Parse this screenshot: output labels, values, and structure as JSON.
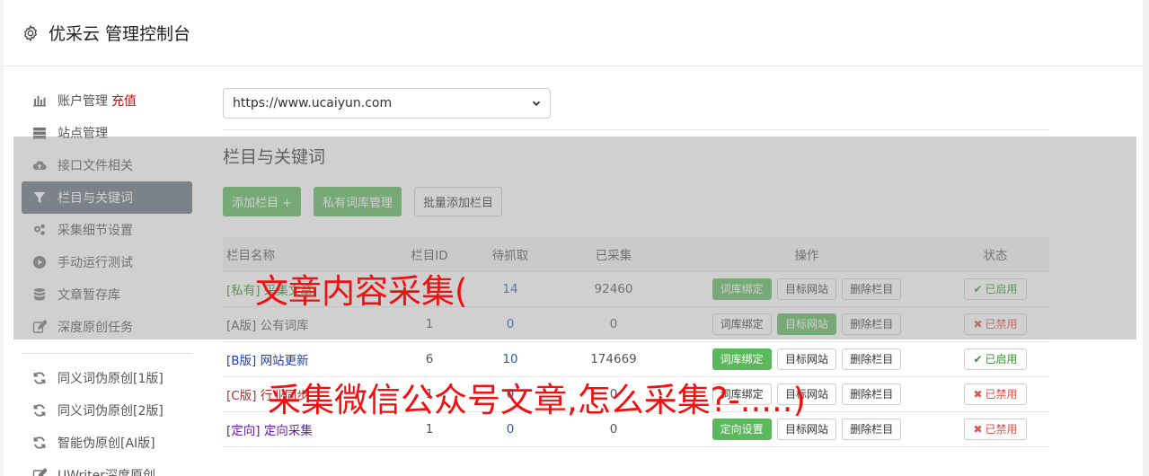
{
  "header": {
    "title": "优采云 管理控制台"
  },
  "sidebar": {
    "items": [
      {
        "label": "账户管理",
        "extra": "充值",
        "icon": "bar-chart-icon"
      },
      {
        "label": "站点管理",
        "icon": "server-icon"
      },
      {
        "label": "接口文件相关",
        "icon": "cloud-upload-icon"
      },
      {
        "label": "栏目与关键词",
        "icon": "filter-icon",
        "active": true
      },
      {
        "label": "采集细节设置",
        "icon": "cogs-icon"
      },
      {
        "label": "手动运行测试",
        "icon": "play-circle-icon"
      },
      {
        "label": "文章暂存库",
        "icon": "database-icon"
      },
      {
        "label": "深度原创任务",
        "icon": "edit-icon"
      }
    ],
    "items2": [
      {
        "label": "同义词伪原创[1版]",
        "icon": "refresh-icon"
      },
      {
        "label": "同义词伪原创[2版]",
        "icon": "refresh-icon"
      },
      {
        "label": "智能伪原创[AI版]",
        "icon": "refresh-icon"
      },
      {
        "label": "UWriter深度原创",
        "icon": "edit-icon"
      }
    ]
  },
  "main": {
    "site_select": "https://www.ucaiyun.com",
    "section_title": "栏目与关键词",
    "toolbar": {
      "add": "添加栏目 +",
      "private": "私有词库管理",
      "batch": "批量添加栏目"
    },
    "table": {
      "headers": [
        "栏目名称",
        "栏目ID",
        "待抓取",
        "已采集",
        "操作",
        "状态"
      ],
      "rows": [
        {
          "tag": "[私有]",
          "name": "采集文章",
          "id": "1",
          "pending": "14",
          "collected": "92460",
          "b1": "词库绑定",
          "b2": "目标网站",
          "b3": "删除栏目",
          "status": "已启用"
        },
        {
          "tag": "[A版]",
          "name": "公有词库",
          "id": "1",
          "pending": "0",
          "collected": "0",
          "b1": "词库绑定",
          "b2": "目标网站",
          "b3": "删除栏目",
          "status": "已禁用"
        },
        {
          "tag": "[B版]",
          "name": "网站更新",
          "id": "6",
          "pending": "10",
          "collected": "174669",
          "b1": "词库绑定",
          "b2": "目标网站",
          "b3": "删除栏目",
          "status": "已启用"
        },
        {
          "tag": "[C版]",
          "name": "行业同步",
          "id": "1",
          "pending": "0",
          "collected": "0",
          "b1": "词库绑定",
          "b2": "目标网站",
          "b3": "删除栏目",
          "status": "已禁用"
        },
        {
          "tag": "[定向]",
          "name": "定向采集",
          "id": "1",
          "pending": "0",
          "collected": "0",
          "b1": "定向设置",
          "b2": "目标网站",
          "b3": "删除栏目",
          "status": "已禁用"
        }
      ]
    }
  },
  "watermark": {
    "line1": "文章内容采集(",
    "line2": "采集微信公众号文章,怎么采集?-.....)"
  },
  "colors": {
    "green": "#5cb85c",
    "active_nav": "#64727f",
    "watermark": "#f01010"
  }
}
